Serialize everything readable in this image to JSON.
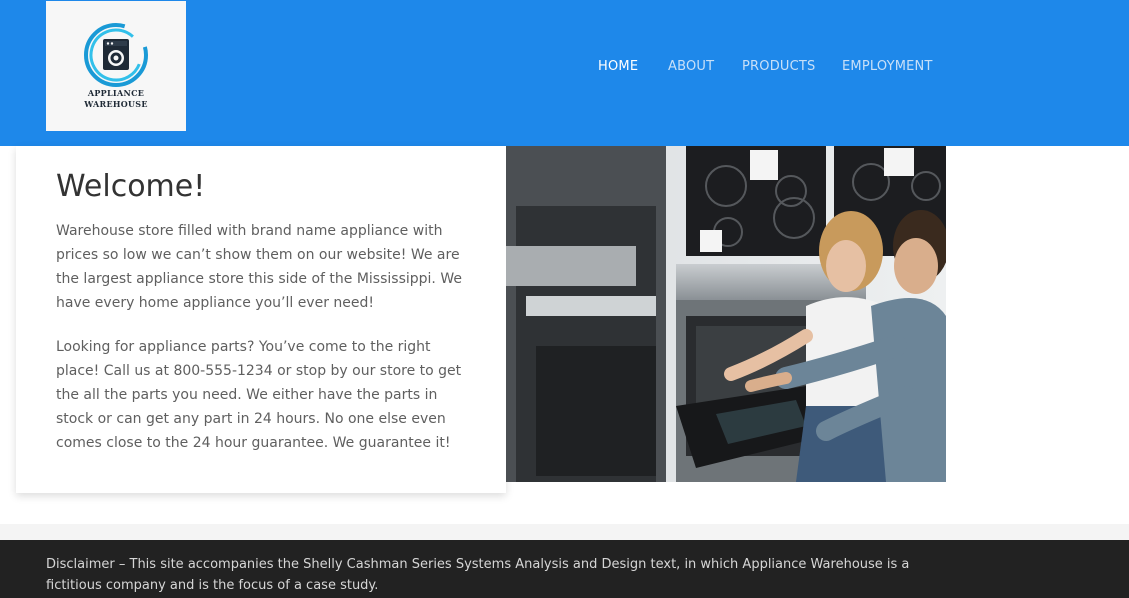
{
  "brand": {
    "line1": "APPLIANCE",
    "line2": "WAREHOUSE"
  },
  "nav": {
    "items": [
      "HOME",
      "ABOUT",
      "PRODUCTS",
      "EMPLOYMENT"
    ],
    "active": "HOME"
  },
  "welcome": {
    "title": "Welcome!",
    "paragraph1": "Warehouse store filled with brand name appliance with prices so low we can’t show them on our website! We are the largest appliance store this side of the Mississippi. We have every home appliance you’ll ever need!",
    "paragraph2": "Looking for appliance parts? You’ve come to the right place! Call us at 800-555-1234 or stop by our store to get the all the parts you need. We either have the parts in stock or can get any part in 24 hours. No one else even comes close to the 24 hour guarantee. We guarantee it!"
  },
  "footer": {
    "disclaimer": "Disclaimer – This site accompanies the Shelly Cashman Series Systems Analysis and Design text, in which Appliance Warehouse is a fictitious company and is the focus of a case study."
  },
  "colors": {
    "header": "#1e88ea",
    "footer": "#222222",
    "nav_active": "#ffffff",
    "nav_inactive": "#c8e0f8"
  }
}
